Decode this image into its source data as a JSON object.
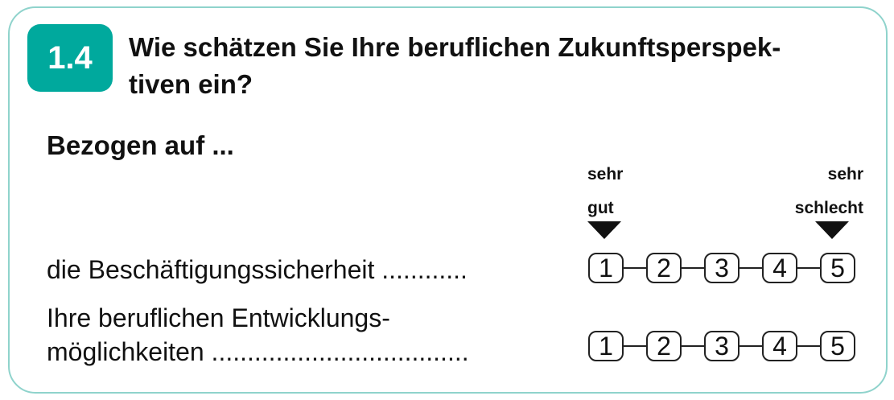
{
  "badge": "1.4",
  "question": "Wie schätzen Sie Ihre beruflichen Zukunftsperspek-tiven ein?",
  "question_line1": "Wie schätzen Sie Ihre beruflichen Zukunftsperspek-",
  "question_line2": "tiven ein?",
  "subheading": "Bezogen auf ...",
  "scale_left": {
    "line1": "sehr",
    "line2": "gut"
  },
  "scale_right": {
    "line1": "sehr",
    "line2": "schlecht"
  },
  "items": [
    {
      "label": "die Beschäftigungssicherheit  ............"
    },
    {
      "label_line1": "Ihre beruflichen Entwicklungs-",
      "label_line2": "möglichkeiten ...................................."
    }
  ],
  "options": [
    "1",
    "2",
    "3",
    "4",
    "5"
  ]
}
